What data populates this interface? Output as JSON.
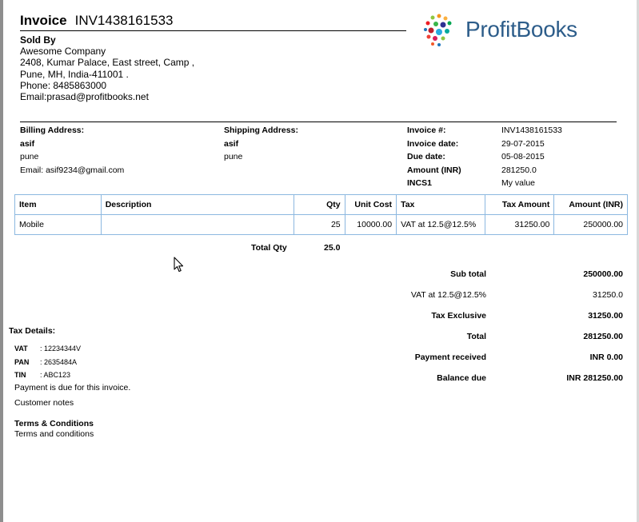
{
  "header": {
    "title_label": "Invoice",
    "invoice_number": "INV1438161533",
    "logo_text": "ProfitBooks"
  },
  "seller": {
    "heading": "Sold By",
    "lines": [
      "Awesome Company",
      "2408, Kumar Palace, East street, Camp ,",
      "Pune, MH, India-411001 .",
      "Phone: 8485863000",
      "Email:prasad@profitbooks.net"
    ]
  },
  "billing": {
    "heading": "Billing Address:",
    "name": "asif",
    "city": "pune",
    "email": "Email: asif9234@gmail.com"
  },
  "shipping": {
    "heading": "Shipping Address:",
    "name": "asif",
    "city": "pune"
  },
  "invoice_meta": [
    {
      "label": "Invoice #:",
      "value": "INV1438161533"
    },
    {
      "label": "Invoice date:",
      "value": "29-07-2015"
    },
    {
      "label": "Due date:",
      "value": "05-08-2015"
    },
    {
      "label": "Amount (INR)",
      "value": "281250.0"
    },
    {
      "label": "INCS1",
      "value": "My value"
    }
  ],
  "table": {
    "columns": [
      "Item",
      "Description",
      "Qty",
      "Unit Cost",
      "Tax",
      "Tax Amount",
      "Amount (INR)"
    ],
    "rows": [
      [
        "Mobile",
        "",
        "25",
        "10000.00",
        "VAT at 12.5@12.5%",
        "31250.00",
        "250000.00"
      ]
    ]
  },
  "total_qty": {
    "label": "Total Qty",
    "value": "25.0"
  },
  "summary": [
    {
      "label": "Sub total",
      "value": "250000.00",
      "bold": true
    },
    {
      "label": "VAT at 12.5@12.5%",
      "value": "31250.0",
      "bold": false
    },
    {
      "label": "Tax Exclusive",
      "value": "31250.00",
      "bold": true
    },
    {
      "label": "Total",
      "value": "281250.00",
      "bold": true
    },
    {
      "label": "Payment received",
      "value": "INR 0.00",
      "bold": true
    },
    {
      "label": "Balance due",
      "value": "INR 281250.00",
      "bold": true
    }
  ],
  "tax_details": {
    "heading": "Tax Details:",
    "items": [
      {
        "key": "VAT",
        "value": ": 12234344V"
      },
      {
        "key": "PAN",
        "value": ": 2635484A"
      },
      {
        "key": "TIN",
        "value": ": ABC123"
      }
    ]
  },
  "notes": {
    "payment_note": "Payment is due for this invoice.",
    "customer_notes": "Customer notes"
  },
  "terms": {
    "heading": "Terms & Conditions",
    "text": "Terms and conditions"
  },
  "colors": {
    "table_border": "#8cb8e0",
    "logo_text": "#2d5d8a"
  }
}
